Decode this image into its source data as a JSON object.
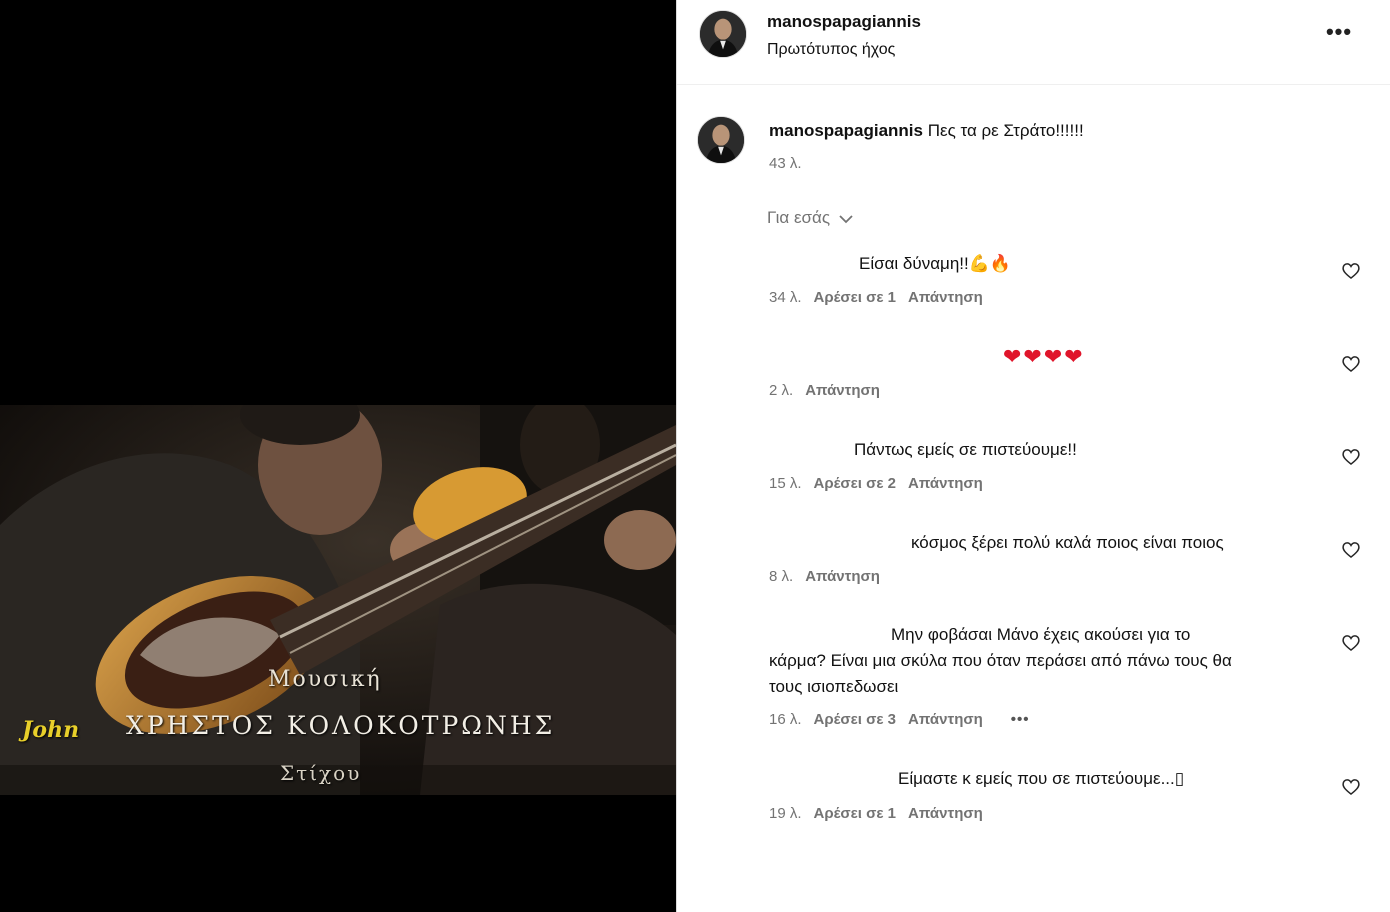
{
  "video": {
    "caption_small": "Μουσική",
    "caption_main": "ΧΡΗΣΤΟΣ ΚΟΛΟΚΟΤΡΩΝΗΣ",
    "caption_john": "John",
    "caption_sub": "Στίχου"
  },
  "header": {
    "username": "manospapagiannis",
    "audio": "Πρωτότυπος ήχος",
    "more": "•••"
  },
  "caption": {
    "username": "manospapagiannis",
    "text": "Πες τα ρε Στράτο!!!!!!",
    "time": "43 λ."
  },
  "sort": {
    "label": "Για εσάς"
  },
  "comments": [
    {
      "text": "Είσαι δύναμη!!",
      "emoji1": "💪",
      "emoji2": "🔥",
      "time": "34 λ.",
      "likes": "Αρέσει σε 1",
      "reply": "Απάντηση"
    },
    {
      "text": "❤❤❤❤",
      "time": "2 λ.",
      "reply": "Απάντηση"
    },
    {
      "text": "Πάντως εμείς σε πιστεύουμε!!",
      "time": "15 λ.",
      "likes": "Αρέσει σε 2",
      "reply": "Απάντηση"
    },
    {
      "text": "κόσμος ξέρει πολύ καλά ποιος είναι ποιος",
      "time": "8 λ.",
      "reply": "Απάντηση"
    },
    {
      "text_line1": "Μην φοβάσαι Μάνο έχεις ακούσει για το",
      "text_line2": "κάρμα? Είναι μια σκύλα που όταν περάσει από πάνω τους θα",
      "text_line3": "τους ισιοπεδωσει",
      "time": "16 λ.",
      "likes": "Αρέσει σε 3",
      "reply": "Απάντηση",
      "more": "•••"
    },
    {
      "text": "Είμαστε κ εμείς που σε πιστεύουμε...",
      "glyph": "▯",
      "time": "19 λ.",
      "likes": "Αρέσει σε 1",
      "reply": "Απάντηση"
    }
  ],
  "colors": {
    "secondary_text": "#737373",
    "heart_red": "#e0152b",
    "caption_yellow": "#e8cf2a"
  }
}
